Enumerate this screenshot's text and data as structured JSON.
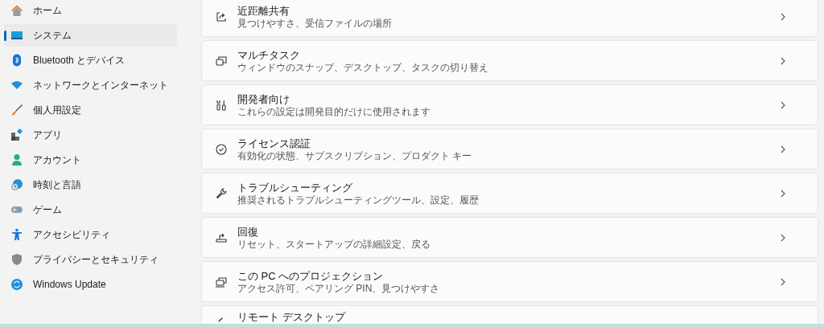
{
  "sidebar": {
    "items": [
      {
        "label": "ホーム",
        "selected": false
      },
      {
        "label": "システム",
        "selected": true
      },
      {
        "label": "Bluetooth とデバイス",
        "selected": false
      },
      {
        "label": "ネットワークとインターネット",
        "selected": false
      },
      {
        "label": "個人用設定",
        "selected": false
      },
      {
        "label": "アプリ",
        "selected": false
      },
      {
        "label": "アカウント",
        "selected": false
      },
      {
        "label": "時刻と言語",
        "selected": false
      },
      {
        "label": "ゲーム",
        "selected": false
      },
      {
        "label": "アクセシビリティ",
        "selected": false
      },
      {
        "label": "プライバシーとセキュリティ",
        "selected": false
      },
      {
        "label": "Windows Update",
        "selected": false
      }
    ]
  },
  "settings": [
    {
      "title": "近距離共有",
      "subtitle": "見つけやすさ、受信ファイルの場所"
    },
    {
      "title": "マルチタスク",
      "subtitle": "ウィンドウのスナップ、デスクトップ、タスクの切り替え"
    },
    {
      "title": "開発者向け",
      "subtitle": "これらの設定は開発目的だけに使用されます"
    },
    {
      "title": "ライセンス認証",
      "subtitle": "有効化の状態、サブスクリプション、プロダクト キー"
    },
    {
      "title": "トラブルシューティング",
      "subtitle": "推奨されるトラブルシューティングツール、設定、履歴"
    },
    {
      "title": "回復",
      "subtitle": "リセット、スタートアップの詳細設定、戻る"
    },
    {
      "title": "この PC へのプロジェクション",
      "subtitle": "アクセス許可、ペアリング PIN、見つけやすさ"
    },
    {
      "title": "リモート デスクトップ"
    }
  ]
}
